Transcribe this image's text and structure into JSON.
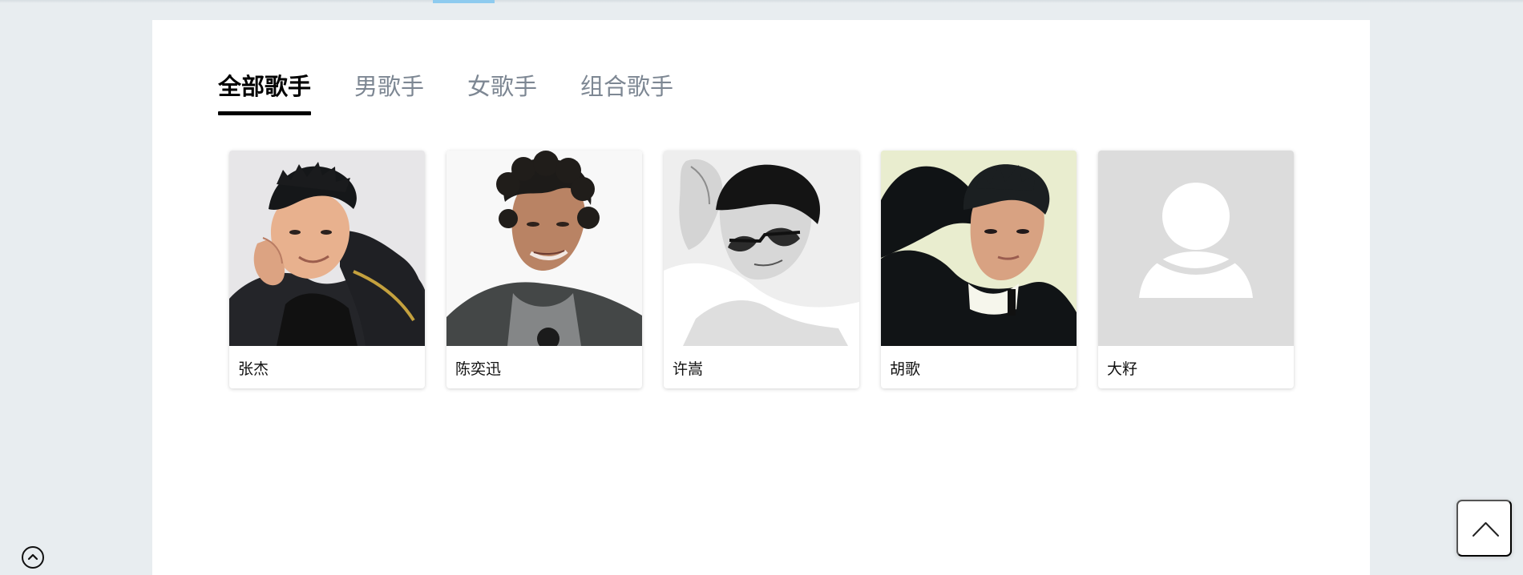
{
  "tabs": [
    {
      "label": "全部歌手",
      "active": true
    },
    {
      "label": "男歌手",
      "active": false
    },
    {
      "label": "女歌手",
      "active": false
    },
    {
      "label": "组合歌手",
      "active": false
    }
  ],
  "singers": [
    {
      "name": "张杰",
      "image": "portrait-man-hand-on-face"
    },
    {
      "name": "陈奕迅",
      "image": "portrait-man-curly-hair"
    },
    {
      "name": "许嵩",
      "image": "portrait-man-glasses-monochrome"
    },
    {
      "name": "胡歌",
      "image": "portrait-man-black-sweater"
    },
    {
      "name": "大籽",
      "image": "default-avatar"
    }
  ],
  "icons": {
    "scroll": "circle-chevron-up-icon",
    "back_to_top": "chevron-up-icon"
  },
  "colors": {
    "background": "#e8edf0",
    "panel": "#ffffff",
    "active_tab": "#000000",
    "inactive_tab": "#7d8793",
    "accent": "#8ecbef"
  }
}
